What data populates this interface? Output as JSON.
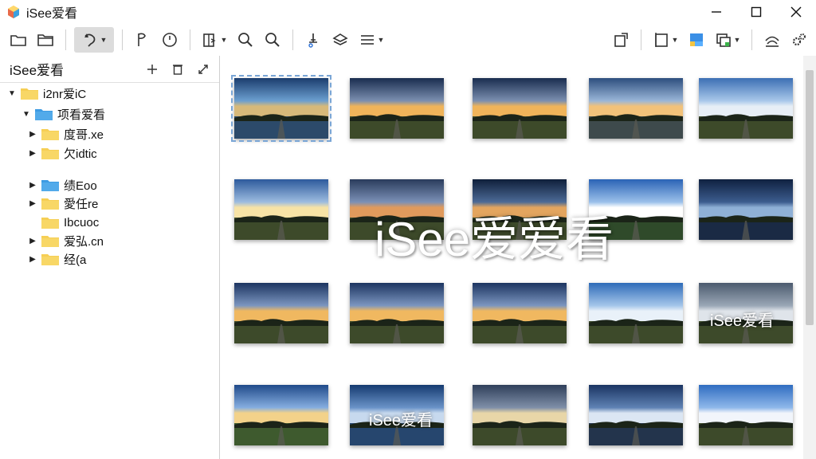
{
  "window": {
    "title": "iSee爱看",
    "controls": {
      "minimize": "minimize",
      "maximize": "maximize",
      "close": "close"
    }
  },
  "toolbar": {
    "buttons": [
      {
        "icon": "folder-open-icon"
      },
      {
        "icon": "folder-icon"
      },
      {
        "icon": "rotate-tool-icon",
        "pressed": true,
        "dropdown": true
      },
      {
        "icon": "flag-icon"
      },
      {
        "icon": "clock-icon"
      },
      {
        "icon": "export-icon",
        "dropdown": true
      },
      {
        "icon": "zoom-in-icon"
      },
      {
        "icon": "zoom-out-icon"
      },
      {
        "icon": "stamp-icon"
      },
      {
        "icon": "layers-icon"
      },
      {
        "icon": "list-menu-icon",
        "dropdown": true
      },
      {
        "icon": "share-icon"
      },
      {
        "icon": "crop-frame-icon",
        "dropdown": true
      },
      {
        "icon": "color-palette-icon"
      },
      {
        "icon": "screenshot-icon",
        "dropdown": true
      },
      {
        "icon": "wifi-arc-icon"
      },
      {
        "icon": "settings-gears-icon"
      }
    ]
  },
  "left_panel": {
    "title": "iSee爱看",
    "tree": [
      {
        "label": "i2nr爱iC",
        "level": 0,
        "expanded": true,
        "color": "#f6cf55"
      },
      {
        "label": "项看爱看",
        "level": 1,
        "expanded": true,
        "color": "#4aa8e8"
      },
      {
        "label": "度哥.xe",
        "level": 2,
        "expanded": false,
        "color": "#f6cf55"
      },
      {
        "label": "欠idtic",
        "level": 2,
        "expanded": false,
        "color": "#f6cf55"
      },
      {
        "label": "绩Eoo",
        "level": 1,
        "expanded": false,
        "color": "#4aa8e8"
      },
      {
        "label": "愛任re",
        "level": 2,
        "expanded": false,
        "color": "#f6cf55"
      },
      {
        "label": "Ibcuoc",
        "level": 2,
        "expanded": false,
        "color": "#f6cf55"
      },
      {
        "label": "爱弘.cn",
        "level": 2,
        "expanded": false,
        "color": "#f6cf55"
      },
      {
        "label": "经(a",
        "level": 2,
        "expanded": false,
        "color": "#f6cf55"
      }
    ]
  },
  "watermarks": {
    "center": "iSee爱爱看",
    "row3": "iSee爱看",
    "row4": "iSee爱看"
  },
  "thumbnails": [
    {
      "scene": "lake-dusk",
      "selected": true
    },
    {
      "scene": "road-sunset"
    },
    {
      "scene": "road-sunset"
    },
    {
      "scene": "lake-road"
    },
    {
      "scene": "mountain-path"
    },
    {
      "scene": "field-sun"
    },
    {
      "scene": "cabin"
    },
    {
      "scene": "road-dark"
    },
    {
      "scene": "forest-lake"
    },
    {
      "scene": "lake-night"
    },
    {
      "scene": "field-dusk"
    },
    {
      "scene": "field-dusk"
    },
    {
      "scene": "field-dusk"
    },
    {
      "scene": "tree-field"
    },
    {
      "scene": "road-cloudy"
    },
    {
      "scene": "canal"
    },
    {
      "scene": "lake-blue"
    },
    {
      "scene": "road-storm"
    },
    {
      "scene": "lake-dark"
    },
    {
      "scene": "path-sky"
    }
  ]
}
